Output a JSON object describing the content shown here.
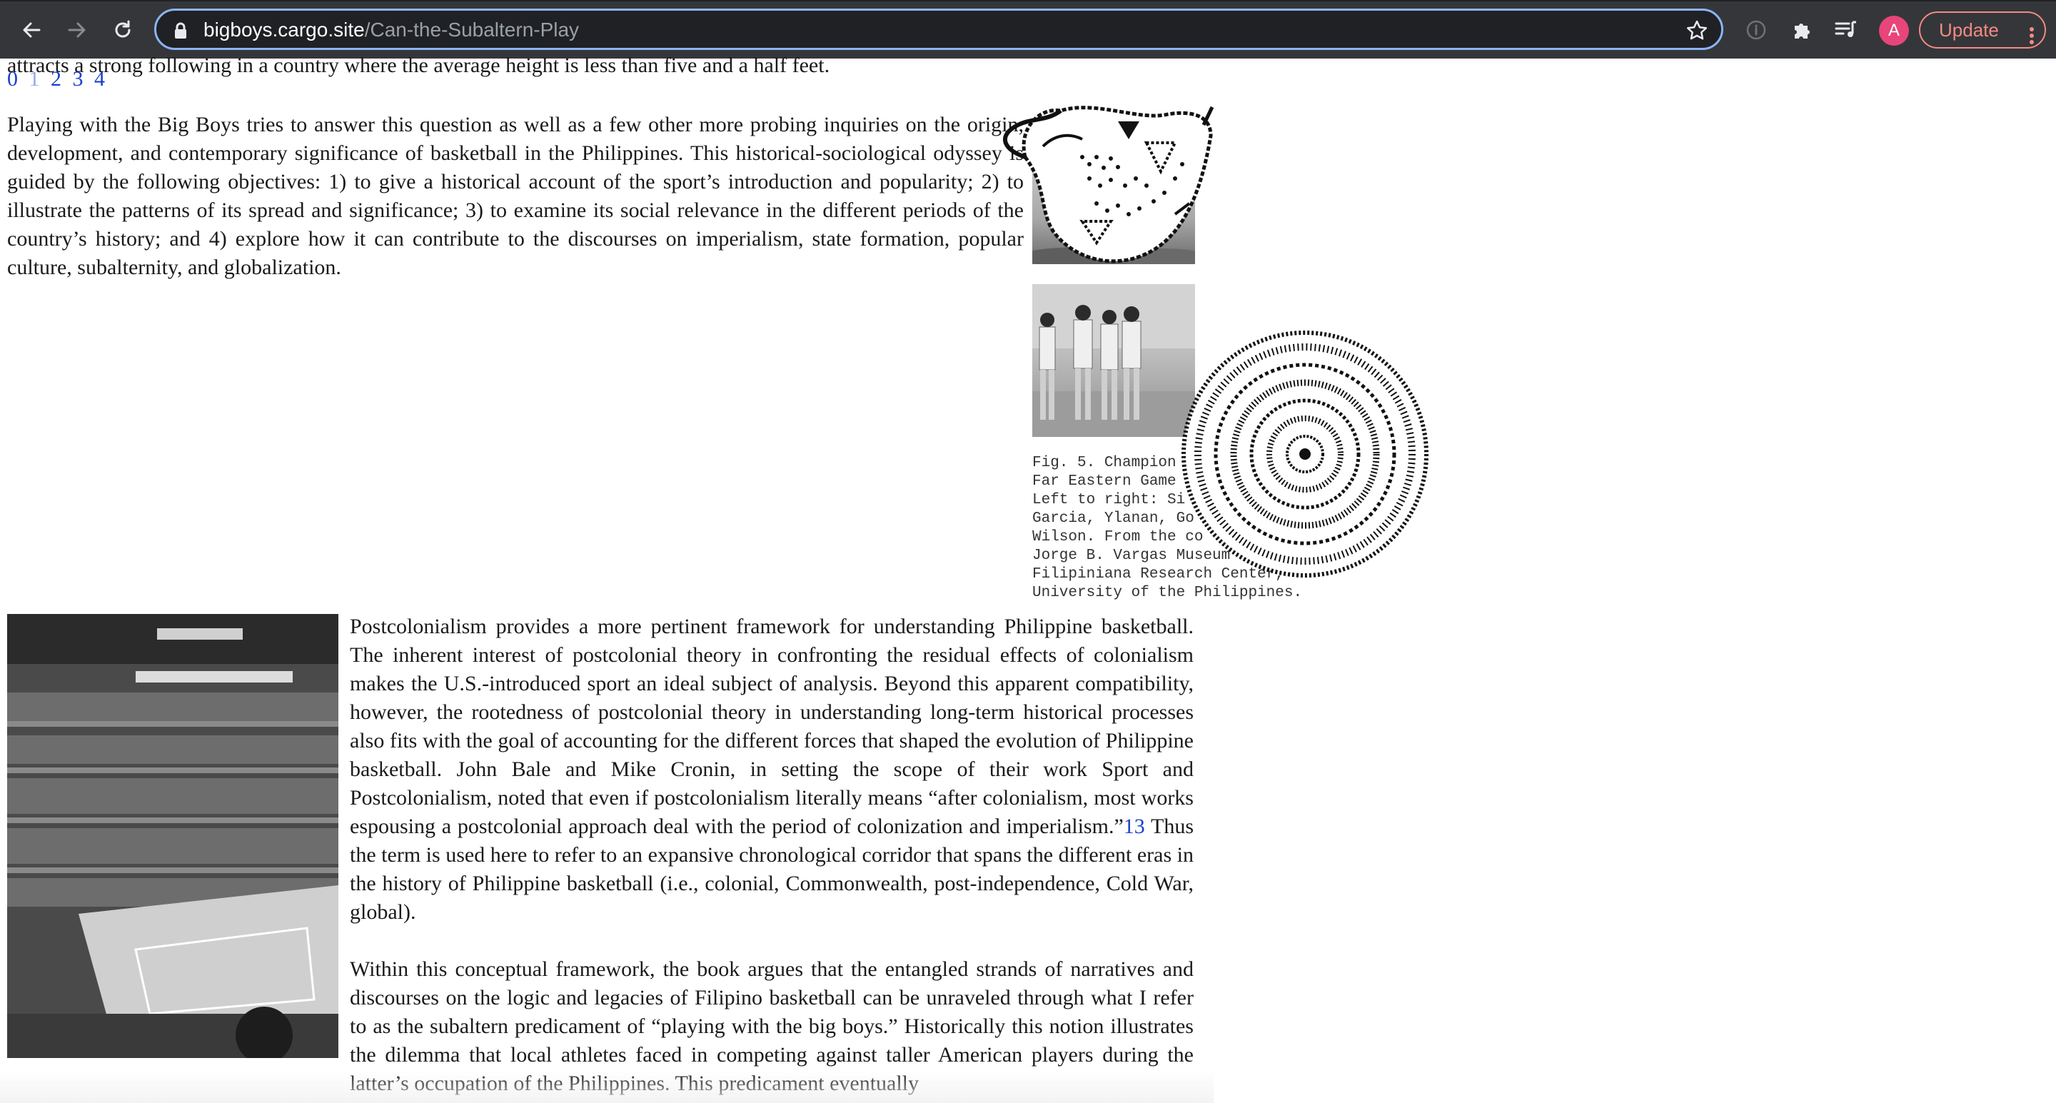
{
  "browser": {
    "url_host": "bigboys.cargo.site",
    "url_path": "/Can-the-Subaltern-Play",
    "avatar_letter": "A",
    "update_label": "Update",
    "icons": [
      "back-arrow-icon",
      "forward-arrow-icon",
      "reload-icon",
      "lock-icon",
      "star-icon",
      "info-icon",
      "extensions-icon",
      "reading-list-icon",
      "more-vert-icon"
    ]
  },
  "page": {
    "pager": [
      "0",
      "1",
      "2",
      "3",
      "4"
    ],
    "top_line": "attracts a strong following in a country where the average height is less than five and a half feet.",
    "paragraph_1": "Playing with the Big Boys tries to answer this question as well as a few other more probing inquiries on the origin, development, and contemporary significance of basketball in the Philippines. This historical-sociological odyssey is guided by the following objectives: 1) to give a historical account of the sport’s introduction and popularity; 2) to illustrate the patterns of its spread and significance; 3) to examine its social relevance in the different periods of the country’s history; and 4) explore how it can contribute to the discourses on imperialism, state formation, popular culture, subalternity, and globalization.",
    "caption": "Fig. 5. Champion\nFar Eastern Game\nLeft to right: Si\nGarcia, Ylanan, Go\nWilson. From the co\nJorge B. Vargas Museum\nFilipiniana Research Center,\nUniversity of the Philippines.",
    "paragraph_2_a": "Postcolonialism provides a more pertinent framework for understanding Philippine basketball. The inherent interest of postcolonial theory in confronting the residual effects of colonialism makes the U.S.-introduced sport an ideal subject of analysis. Beyond this apparent compatibility, however, the rootedness of postcolonial theory in understanding long-term historical processes also fits with the goal of accounting for the different forces that shaped the evolution of Philippine basketball. John Bale and Mike Cronin, in setting the scope of their work Sport and Postcolonialism, noted that even if postcolonialism literally means “after colonialism, most works espousing a postcolonial approach deal with the period of colonization and imperialism.”",
    "footnote_ref": "13",
    "paragraph_2_b": " Thus the term is used here to refer to an expansive chronological corridor that spans the different eras in the history of Philippine basketball (i.e., colonial, Commonwealth, post-independence, Cold War, global).",
    "paragraph_3": "Within this conceptual framework, the book argues that the entangled strands of narratives and discourses on the logic and legacies of Filipino basketball can be unraveled through what I refer to as the subaltern predicament of “playing with the big boys.” Historically this notion illustrates the dilemma that local athletes faced in competing against taller American players during the latter’s occupation of the Philippines. This predicament eventually"
  },
  "colors": {
    "chrome_bg": "#35363a",
    "omnibox_border": "#8ab4f8",
    "link_blue": "#1a3fd0",
    "update_red": "#f28b82",
    "avatar_pink": "#e8457a"
  }
}
